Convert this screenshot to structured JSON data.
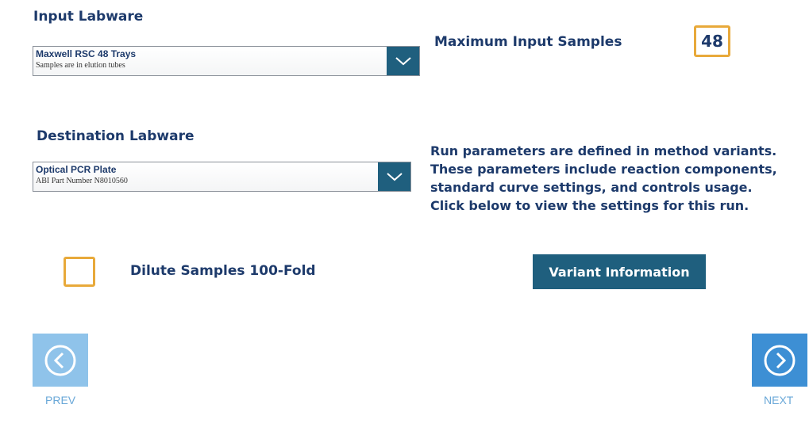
{
  "input_labware": {
    "title": "Input Labware",
    "selected_main": "Maxwell RSC 48 Trays",
    "selected_sub": "Samples are in elution tubes"
  },
  "max_samples": {
    "label": "Maximum Input Samples",
    "value": "48"
  },
  "destination_labware": {
    "title": "Destination Labware",
    "selected_main": "Optical PCR Plate",
    "selected_sub": "ABI Part Number N8010560"
  },
  "info_text": "Run parameters are defined in method variants.\nThese parameters include reaction components,\nstandard curve settings, and controls usage.\nClick below to view the settings for this run.",
  "dilute": {
    "label": "Dilute Samples 100-Fold",
    "checked": false
  },
  "variant_button": "Variant Information",
  "nav": {
    "prev_label": "PREV",
    "next_label": "NEXT",
    "prev_icon": "chevron-left-circle-icon",
    "next_icon": "chevron-right-circle-icon"
  },
  "colors": {
    "primary_text": "#1d3a6b",
    "accent_orange": "#e8a93a",
    "button_teal": "#1f5f7e",
    "prev_button": "#8fc3ea",
    "next_button": "#3d8fd4"
  }
}
